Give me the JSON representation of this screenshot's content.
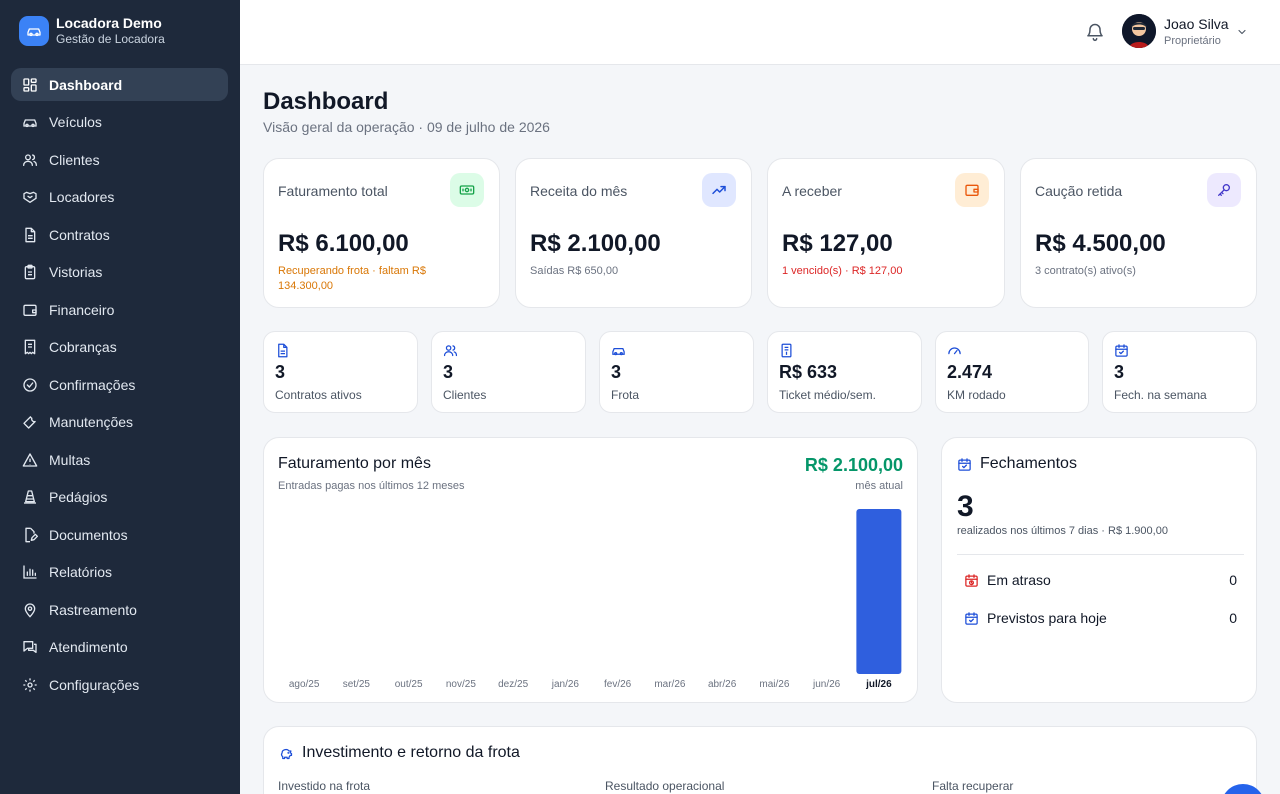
{
  "brand": {
    "title": "Locadora Demo",
    "subtitle": "Gestão de Locadora"
  },
  "sidebar": {
    "items": [
      {
        "label": "Dashboard",
        "icon": "dashboard-icon",
        "active": true
      },
      {
        "label": "Veículos",
        "icon": "car-icon"
      },
      {
        "label": "Clientes",
        "icon": "users-icon"
      },
      {
        "label": "Locadores",
        "icon": "handshake-icon"
      },
      {
        "label": "Contratos",
        "icon": "file-text-icon"
      },
      {
        "label": "Vistorias",
        "icon": "clipboard-icon"
      },
      {
        "label": "Financeiro",
        "icon": "wallet-icon"
      },
      {
        "label": "Cobranças",
        "icon": "receipt-icon"
      },
      {
        "label": "Confirmações",
        "icon": "check-circle-icon"
      },
      {
        "label": "Manutenções",
        "icon": "wrench-icon"
      },
      {
        "label": "Multas",
        "icon": "alert-triangle-icon"
      },
      {
        "label": "Pedágios",
        "icon": "cone-icon"
      },
      {
        "label": "Documentos",
        "icon": "file-edit-icon"
      },
      {
        "label": "Relatórios",
        "icon": "bar-chart-icon"
      },
      {
        "label": "Rastreamento",
        "icon": "map-pin-icon"
      },
      {
        "label": "Atendimento",
        "icon": "chat-icon"
      },
      {
        "label": "Configurações",
        "icon": "gear-icon"
      }
    ]
  },
  "header": {
    "user_name": "Joao Silva",
    "user_role": "Proprietário"
  },
  "page": {
    "title": "Dashboard",
    "subtitle": "Visão geral da operação · 09 de julho de 2026"
  },
  "kpis": [
    {
      "label": "Faturamento total",
      "value": "R$ 6.100,00",
      "note": "Recuperando frota · faltam R$ 134.300,00",
      "note_color": "#d97706",
      "icon": "money-icon",
      "icon_bg": "#dcfce7",
      "icon_color": "#16a34a"
    },
    {
      "label": "Receita do mês",
      "value": "R$ 2.100,00",
      "note": "Saídas R$ 650,00",
      "note_color": "#6b7280",
      "icon": "trending-up-icon",
      "icon_bg": "#e0e7ff",
      "icon_color": "#1d4ed8"
    },
    {
      "label": "A receber",
      "value": "R$ 127,00",
      "note": "1 vencido(s) · R$ 127,00",
      "note_color": "#dc2626",
      "icon": "wallet-icon",
      "icon_bg": "#ffedd5",
      "icon_color": "#ea580c"
    },
    {
      "label": "Caução retida",
      "value": "R$ 4.500,00",
      "note": "3 contrato(s) ativo(s)",
      "note_color": "#6b7280",
      "icon": "key-icon",
      "icon_bg": "#ede9fe",
      "icon_color": "#4338ca"
    }
  ],
  "stats": [
    {
      "value": "3",
      "label": "Contratos ativos",
      "icon": "file-text-icon"
    },
    {
      "value": "3",
      "label": "Clientes",
      "icon": "users-icon"
    },
    {
      "value": "3",
      "label": "Frota",
      "icon": "car-icon"
    },
    {
      "value": "R$ 633",
      "label": "Ticket médio/sem.",
      "icon": "receipt-icon"
    },
    {
      "value": "2.474",
      "label": "KM rodado",
      "icon": "gauge-icon"
    },
    {
      "value": "3",
      "label": "Fech. na semana",
      "icon": "calendar-check-icon"
    }
  ],
  "revenue_panel": {
    "title": "Faturamento por mês",
    "subtitle": "Entradas pagas nos últimos 12 meses",
    "total": "R$ 2.100,00",
    "total_caption": "mês atual"
  },
  "chart_data": {
    "type": "bar",
    "categories": [
      "ago/25",
      "set/25",
      "out/25",
      "nov/25",
      "dez/25",
      "jan/26",
      "fev/26",
      "mar/26",
      "abr/26",
      "mai/26",
      "jun/26",
      "jul/26"
    ],
    "values": [
      0,
      0,
      0,
      0,
      0,
      0,
      0,
      0,
      0,
      0,
      0,
      2100
    ],
    "highlight": "jul/26",
    "bar_color": "#2f5fde",
    "grid": false,
    "ylim": [
      0,
      2100
    ]
  },
  "fechamentos": {
    "title": "Fechamentos",
    "count": "3",
    "subtitle": "realizados nos últimos 7 dias · R$ 1.900,00",
    "rows": [
      {
        "label": "Em atraso",
        "value": "0",
        "icon": "clock-alert-icon",
        "color": "#dc2626"
      },
      {
        "label": "Previstos para hoje",
        "value": "0",
        "icon": "calendar-check-icon",
        "color": "#1d4ed8"
      }
    ]
  },
  "investment": {
    "title": "Investimento e retorno da frota",
    "columns": [
      "Investido na frota",
      "Resultado operacional",
      "Falta recuperar"
    ]
  }
}
